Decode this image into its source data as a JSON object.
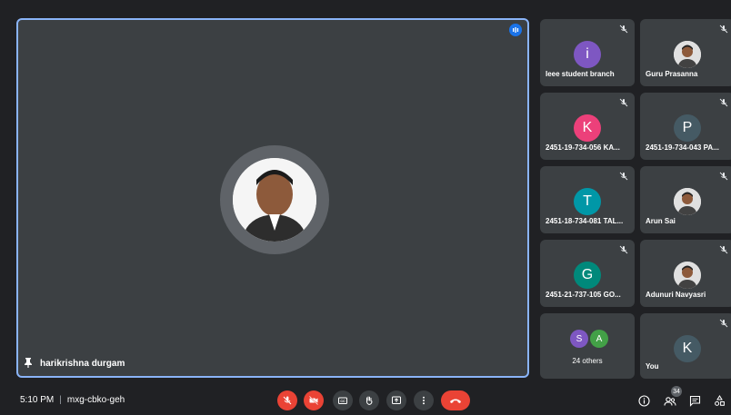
{
  "main": {
    "presenter_name": "harikrishna durgam"
  },
  "participants": [
    {
      "name": "Ieee student branch",
      "initial": "i",
      "color": "#7e57c2",
      "photo": false
    },
    {
      "name": "Guru Prasanna",
      "initial": "",
      "color": "#ffffff",
      "photo": true
    },
    {
      "name": "2451-19-734-056 KA...",
      "initial": "K",
      "color": "#ec407a",
      "photo": false
    },
    {
      "name": "2451-19-734-043 PA...",
      "initial": "P",
      "color": "#455a64",
      "photo": false
    },
    {
      "name": "2451-18-734-081 TAL...",
      "initial": "T",
      "color": "#0097a7",
      "photo": false
    },
    {
      "name": "Arun Sai",
      "initial": "",
      "color": "#ffffff",
      "photo": true
    },
    {
      "name": "2451-21-737-105 GO...",
      "initial": "G",
      "color": "#00897b",
      "photo": false
    },
    {
      "name": "Adunuri Navyasri",
      "initial": "",
      "color": "#9e9e9e",
      "photo": true
    }
  ],
  "others": {
    "label": "24 others",
    "initials": [
      "S",
      "A"
    ],
    "colors": [
      "#7e57c2",
      "#43a047"
    ]
  },
  "self_tile": {
    "name": "You",
    "initial": "K",
    "color": "#455a64"
  },
  "bottom_bar": {
    "time": "5:10 PM",
    "meeting_code": "mxg-cbko-geh",
    "participant_count": "34"
  }
}
